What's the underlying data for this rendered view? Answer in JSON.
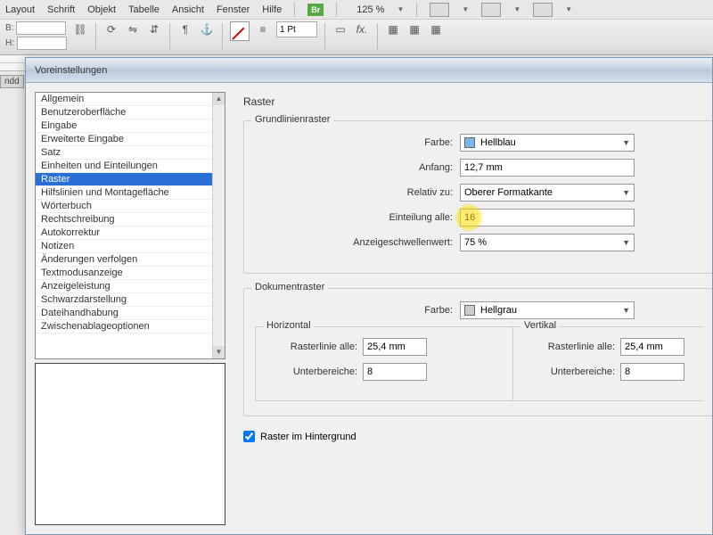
{
  "menubar": {
    "items": [
      "Layout",
      "Schrift",
      "Objekt",
      "Tabelle",
      "Ansicht",
      "Fenster",
      "Hilfe"
    ],
    "br": "Br",
    "zoom": "125 %"
  },
  "toolbar": {
    "b_label": "B:",
    "h_label": "H:",
    "pt_value": "1 Pt"
  },
  "doc_tab": "ndd",
  "dialog": {
    "title": "Voreinstellungen",
    "sidebar": {
      "items": [
        "Allgemein",
        "Benutzeroberfläche",
        "Eingabe",
        "Erweiterte Eingabe",
        "Satz",
        "Einheiten und Einteilungen",
        "Raster",
        "Hilfslinien und Montagefläche",
        "Wörterbuch",
        "Rechtschreibung",
        "Autokorrektur",
        "Notizen",
        "Änderungen verfolgen",
        "Textmodusanzeige",
        "Anzeigeleistung",
        "Schwarzdarstellung",
        "Dateihandhabung",
        "Zwischenablageoptionen"
      ],
      "selected_index": 6
    },
    "heading": "Raster",
    "baseline": {
      "legend": "Grundlinienraster",
      "color_label": "Farbe:",
      "color_value": "Hellblau",
      "color_swatch": "#7ab8e6",
      "start_label": "Anfang:",
      "start_value": "12,7 mm",
      "relative_label": "Relativ zu:",
      "relative_value": "Oberer Formatkante",
      "increment_label": "Einteilung alle:",
      "increment_value": "16",
      "threshold_label": "Anzeigeschwellenwert:",
      "threshold_value": "75 %"
    },
    "docgrid": {
      "legend": "Dokumentraster",
      "color_label": "Farbe:",
      "color_value": "Hellgrau",
      "color_swatch": "#cccccc",
      "horizontal": {
        "legend": "Horizontal",
        "gridline_label": "Rasterlinie alle:",
        "gridline_value": "25,4 mm",
        "subdivisions_label": "Unterbereiche:",
        "subdivisions_value": "8"
      },
      "vertical": {
        "legend": "Vertikal",
        "gridline_label": "Rasterlinie alle:",
        "gridline_value": "25,4 mm",
        "subdivisions_label": "Unterbereiche:",
        "subdivisions_value": "8"
      }
    },
    "grids_in_back_label": "Raster im Hintergrund",
    "grids_in_back_checked": true
  }
}
